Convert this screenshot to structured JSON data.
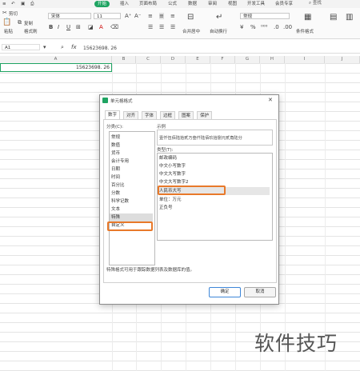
{
  "menu": {
    "tabs": [
      "开始",
      "插入",
      "页面布局",
      "公式",
      "数据",
      "审阅",
      "视图",
      "开发工具",
      "会员专享"
    ],
    "active": "开始",
    "search": "查找"
  },
  "ribbon": {
    "cut": "剪切",
    "copy": "复制",
    "paste": "粘贴",
    "format_painter": "格式刷",
    "font_name": "宋体",
    "font_size": "11",
    "bold": "B",
    "italic": "I",
    "underline": "U",
    "merge_center": "合并居中",
    "wrap_text": "自动换行",
    "number_format": "常规",
    "conditional_format": "条件格式",
    "currency": "¥",
    "percent": "%"
  },
  "formula_bar": {
    "cell_ref": "A1",
    "fx": "fx",
    "value": "15623698. 26"
  },
  "sheet": {
    "columns": [
      "A",
      "B",
      "C",
      "D",
      "E",
      "F",
      "G",
      "H",
      "I",
      "J"
    ],
    "a1_value": "15623698. 26"
  },
  "dialog": {
    "title": "单元格格式",
    "tabs": [
      "数字",
      "对齐",
      "字体",
      "边框",
      "图案",
      "保护"
    ],
    "active_tab": "数字",
    "category_label": "分类(C):",
    "categories": [
      "常规",
      "数值",
      "货币",
      "会计专用",
      "日期",
      "时间",
      "百分比",
      "分数",
      "科学记数",
      "文本",
      "特殊",
      "自定义"
    ],
    "selected_category": "特殊",
    "sample_label": "示例",
    "sample_value": "壹仟伍佰陆拾贰万叁仟陆佰玖拾捌元贰角陆分",
    "type_label": "类型(T):",
    "types": [
      "邮政编码",
      "中文小写数字",
      "中文大写数字",
      "中文大写数字2",
      "人民币大写",
      "单位：万元",
      "正负号"
    ],
    "selected_type": "人民币大写",
    "description": "特殊格式可用于跟踪数据列表及数据库的值。",
    "ok": "确定",
    "cancel": "取消"
  },
  "watermark": "软件技巧",
  "colors": {
    "accent": "#1fa462",
    "highlight": "#e8792a"
  }
}
